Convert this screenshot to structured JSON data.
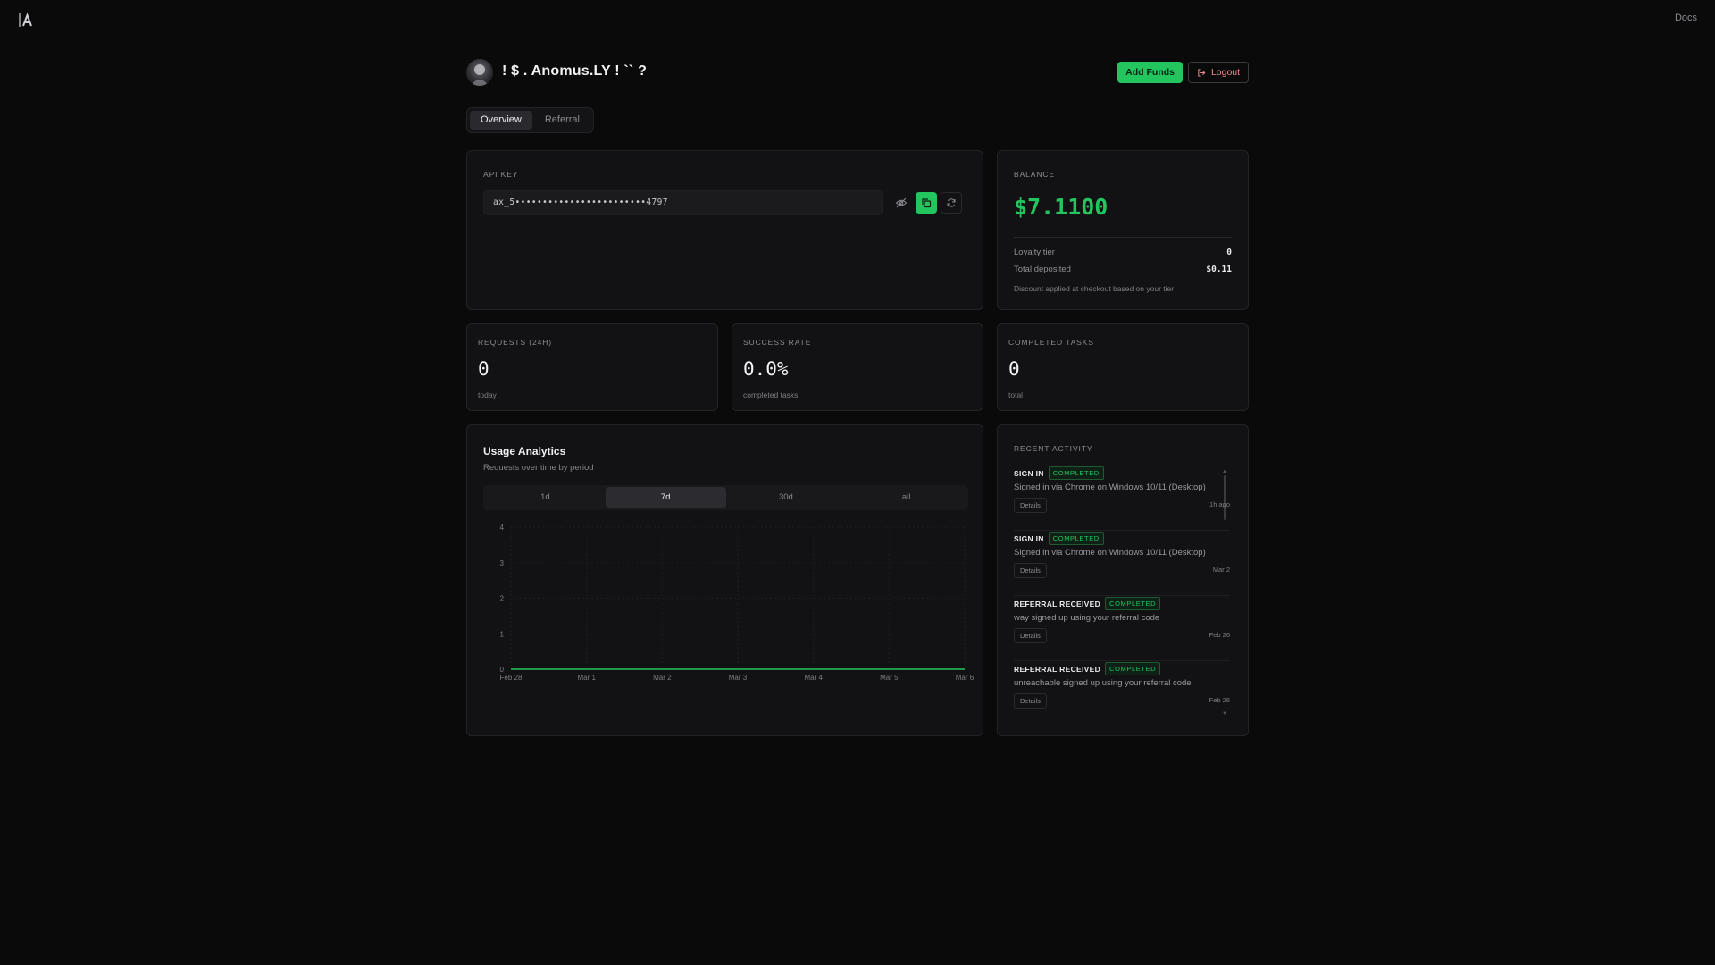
{
  "app": {
    "docs_label": "Docs"
  },
  "header": {
    "username": "! $ . Anomus.LY ! `` ?",
    "add_funds_label": "Add Funds",
    "logout_label": "Logout"
  },
  "tabs": [
    {
      "label": "Overview",
      "active": true
    },
    {
      "label": "Referral",
      "active": false
    }
  ],
  "api_key": {
    "label": "API KEY",
    "masked_value": "ax_5••••••••••••••••••••••••4797"
  },
  "balance": {
    "label": "BALANCE",
    "value": "$7.1100",
    "loyalty_label": "Loyalty tier",
    "loyalty_value": "0",
    "deposited_label": "Total deposited",
    "deposited_value": "$0.11",
    "note": "Discount applied at checkout based on your tier"
  },
  "stats": [
    {
      "label": "REQUESTS (24H)",
      "value": "0",
      "sub": "today"
    },
    {
      "label": "SUCCESS RATE",
      "value": "0.0%",
      "sub": "completed tasks"
    },
    {
      "label": "COMPLETED TASKS",
      "value": "0",
      "sub": "total"
    }
  ],
  "analytics": {
    "title": "Usage Analytics",
    "subtitle": "Requests over time by period",
    "periods": [
      "1d",
      "7d",
      "30d",
      "all"
    ],
    "active_period": "7d"
  },
  "chart_data": {
    "type": "line",
    "categories": [
      "Feb 28",
      "Mar 1",
      "Mar 2",
      "Mar 3",
      "Mar 4",
      "Mar 5",
      "Mar 6"
    ],
    "series": [
      {
        "values": [
          0,
          0,
          0,
          0,
          0,
          0,
          0
        ],
        "color": "#22c55e"
      }
    ],
    "yticks": [
      0,
      1,
      2,
      3,
      4
    ],
    "ylim": [
      0,
      4
    ],
    "grid": true
  },
  "activity": {
    "label": "RECENT ACTIVITY",
    "details_label": "Details",
    "items": [
      {
        "type": "SIGN IN",
        "status": "COMPLETED",
        "description": "Signed in via Chrome on Windows 10/11 (Desktop)",
        "time": "1h ago"
      },
      {
        "type": "SIGN IN",
        "status": "COMPLETED",
        "description": "Signed in via Chrome on Windows 10/11 (Desktop)",
        "time": "Mar 2"
      },
      {
        "type": "REFERRAL RECEIVED",
        "status": "COMPLETED",
        "description": "way signed up using your referral code",
        "time": "Feb 26"
      },
      {
        "type": "REFERRAL RECEIVED",
        "status": "COMPLETED",
        "description": "unreachable signed up using your referral code",
        "time": "Feb 26"
      }
    ]
  },
  "colors": {
    "accent": "#22c55e",
    "background": "#0a0a0b",
    "card": "#121214",
    "danger": "#ef8a8a"
  }
}
